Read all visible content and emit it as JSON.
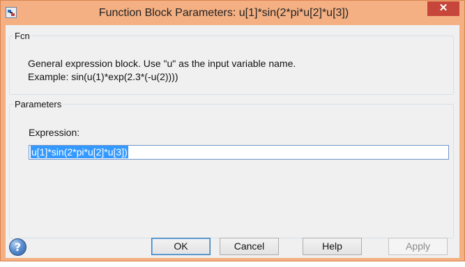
{
  "window": {
    "title": "Function Block Parameters: u[1]*sin(2*pi*u[2]*u[3])",
    "close_glyph": "✕"
  },
  "fcn_group": {
    "legend": "Fcn",
    "line1": "General expression block. Use \"u\" as the input variable name.",
    "line2": "Example: sin(u(1)*exp(2.3*(-u(2))))"
  },
  "parameters_group": {
    "legend": "Parameters",
    "expression_label": "Expression:",
    "expression_value": "u[1]*sin(2*pi*u[2]*u[3])"
  },
  "buttons": {
    "ok": "OK",
    "cancel": "Cancel",
    "help": "Help",
    "apply": "Apply"
  },
  "help_icon_glyph": "?",
  "colors": {
    "frame": "#f4b083",
    "close_button": "#c7463b",
    "selection": "#3399ff"
  }
}
